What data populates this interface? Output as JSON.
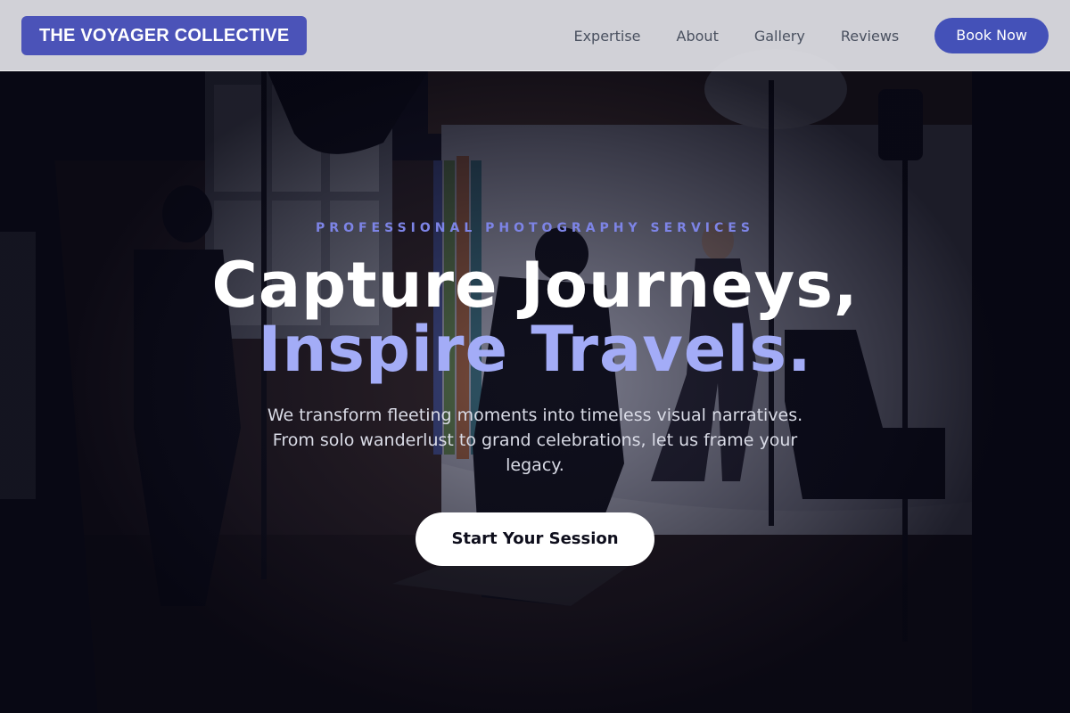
{
  "header": {
    "logo": "THE VOYAGER COLLECTIVE",
    "nav": [
      {
        "label": "Expertise"
      },
      {
        "label": "About"
      },
      {
        "label": "Gallery"
      },
      {
        "label": "Reviews"
      }
    ],
    "book_label": "Book Now"
  },
  "hero": {
    "eyebrow": "PROFESSIONAL PHOTOGRAPHY SERVICES",
    "headline_line1": "Capture Journeys,",
    "headline_line2": "Inspire Travels.",
    "subtext": "We transform fleeting moments into timeless visual narratives. From solo wanderlust to grand celebrations, let us frame your legacy.",
    "cta_label": "Start Your Session"
  },
  "colors": {
    "brand": "#4b53b8",
    "accent_text": "#a3acf7",
    "eyebrow": "#7d84e6",
    "header_bg": "#e1e1e6"
  }
}
